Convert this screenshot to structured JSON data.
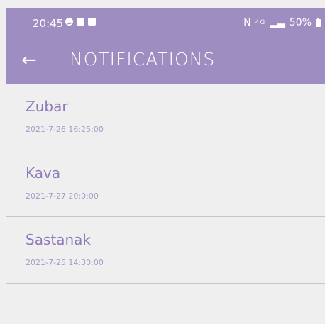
{
  "status_bar": {
    "time": "20:45",
    "right_signal": "N",
    "network": "4G",
    "battery": "50%",
    "icons": [
      "messenger-icon",
      "gallery-icon",
      "check-box-icon",
      "mute-icon",
      "signal-icon",
      "battery-icon"
    ]
  },
  "app_bar": {
    "title": "NOTIFICATIONS",
    "back_icon": "arrow-left-icon"
  },
  "notifications": [
    {
      "title": "Zubar",
      "datetime": "2021-7-26 16:25:00"
    },
    {
      "title": "Kava",
      "datetime": "2021-7-27 20:0:00"
    },
    {
      "title": "Sastanak",
      "datetime": "2021-7-25 14:30:00"
    }
  ],
  "colors": {
    "header": "#9d8dc1",
    "background": "#efefef",
    "text_primary": "#8e7bb9",
    "text_secondary": "#a79ac5"
  }
}
